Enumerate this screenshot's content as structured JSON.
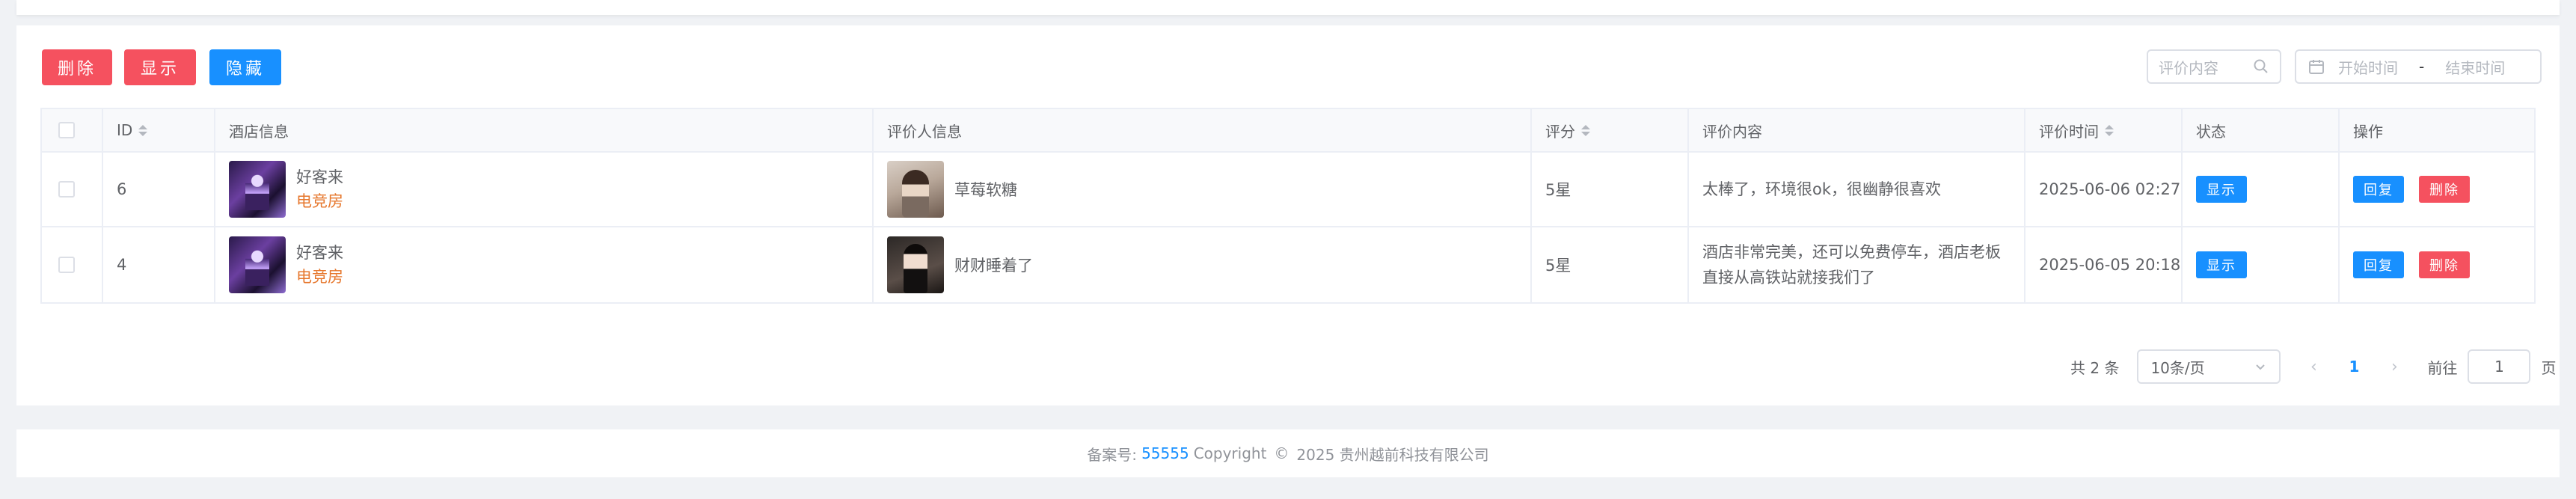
{
  "toolbar": {
    "delete_label": "删除",
    "show_label": "显示",
    "hide_label": "隐藏",
    "search_placeholder": "评价内容",
    "date_start_placeholder": "开始时间",
    "date_separator": "-",
    "date_end_placeholder": "结束时间"
  },
  "colors": {
    "danger": "#f5515f",
    "primary": "#1890ff",
    "hotel_type": "#e6762b"
  },
  "table": {
    "headers": {
      "id": "ID",
      "hotel": "酒店信息",
      "reviewer": "评价人信息",
      "score": "评分",
      "content": "评价内容",
      "time": "评价时间",
      "status": "状态",
      "ops": "操作"
    },
    "rows": [
      {
        "id": "6",
        "hotel_name": "好客来",
        "hotel_type": "电竞房",
        "reviewer": "草莓软糖",
        "score": "5星",
        "content": "太棒了，环境很ok，很幽静很喜欢",
        "time": "2025-06-06 02:27",
        "status_btn": "显示",
        "reply_btn": "回复",
        "delete_btn": "删除"
      },
      {
        "id": "4",
        "hotel_name": "好客来",
        "hotel_type": "电竞房",
        "reviewer": "财财睡着了",
        "score": "5星",
        "content": "酒店非常完美，还可以免费停车，酒店老板直接从高铁站就接我们了",
        "time": "2025-06-05 20:18",
        "status_btn": "显示",
        "reply_btn": "回复",
        "delete_btn": "删除"
      }
    ]
  },
  "pagination": {
    "total": "共 2 条",
    "page_size": "10条/页",
    "current_page": "1",
    "goto_label": "前往",
    "goto_value": "1",
    "goto_unit": "页"
  },
  "footer": {
    "icp_label": "备案号:",
    "icp_number": "55555",
    "copyright_label": "Copyright",
    "copyright_symbol": "©",
    "copyright_text": "2025 贵州越前科技有限公司"
  }
}
